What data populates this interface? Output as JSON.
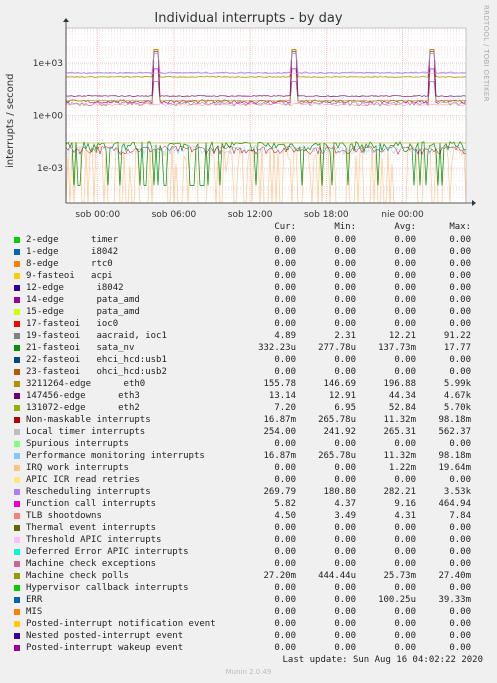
{
  "chart_data": {
    "type": "line",
    "title": "Individual interrupts - by day",
    "ylabel": "interrupts / second",
    "yscale": "log",
    "ylim": [
      1e-05,
      100000
    ],
    "yticks": [
      "1e+03",
      "1e+00",
      "1e-03"
    ],
    "xticks": [
      "sob 00:00",
      "sob 06:00",
      "sob 12:00",
      "sob 18:00",
      "nie 00:00"
    ],
    "columns": [
      "Cur:",
      "Min:",
      "Avg:",
      "Max:"
    ],
    "series": [
      {
        "name": "2-edge      timer",
        "color": "#00cc00",
        "values": [
          "0.00",
          "0.00",
          "0.00",
          "0.00"
        ]
      },
      {
        "name": "1-edge      i8042",
        "color": "#0066b3",
        "values": [
          "0.00",
          "0.00",
          "0.00",
          "0.00"
        ]
      },
      {
        "name": "8-edge      rtc0",
        "color": "#ff8000",
        "values": [
          "0.00",
          "0.00",
          "0.00",
          "0.00"
        ]
      },
      {
        "name": "9-fasteoi   acpi",
        "color": "#ffcc00",
        "values": [
          "0.00",
          "0.00",
          "0.00",
          "0.00"
        ]
      },
      {
        "name": "12-edge      i8042",
        "color": "#330099",
        "values": [
          "0.00",
          "0.00",
          "0.00",
          "0.00"
        ]
      },
      {
        "name": "14-edge      pata_amd",
        "color": "#990099",
        "values": [
          "0.00",
          "0.00",
          "0.00",
          "0.00"
        ]
      },
      {
        "name": "15-edge      pata_amd",
        "color": "#ccff00",
        "values": [
          "0.00",
          "0.00",
          "0.00",
          "0.00"
        ]
      },
      {
        "name": "17-fasteoi   ioc0",
        "color": "#ff0000",
        "values": [
          "0.00",
          "0.00",
          "0.00",
          "0.00"
        ]
      },
      {
        "name": "19-fasteoi   aacraid, ioc1",
        "color": "#808080",
        "values": [
          "4.89",
          "2.31",
          "12.21",
          "91.22"
        ]
      },
      {
        "name": "21-fasteoi   sata_nv",
        "color": "#008f00",
        "values": [
          "332.23u",
          "277.78u",
          "137.73m",
          "17.77"
        ]
      },
      {
        "name": "22-fasteoi   ehci_hcd:usb1",
        "color": "#00487d",
        "values": [
          "0.00",
          "0.00",
          "0.00",
          "0.00"
        ]
      },
      {
        "name": "23-fasteoi   ohci_hcd:usb2",
        "color": "#b35a00",
        "values": [
          "0.00",
          "0.00",
          "0.00",
          "0.00"
        ]
      },
      {
        "name": "3211264-edge      eth0",
        "color": "#b38f00",
        "values": [
          "155.78",
          "146.69",
          "196.88",
          "5.99k"
        ]
      },
      {
        "name": "147456-edge      eth3",
        "color": "#6b006b",
        "values": [
          "13.14",
          "12.91",
          "44.34",
          "4.67k"
        ]
      },
      {
        "name": "131072-edge      eth2",
        "color": "#8fb300",
        "values": [
          "7.20",
          "6.95",
          "52.84",
          "5.70k"
        ]
      },
      {
        "name": "Non-maskable interrupts",
        "color": "#b30000",
        "values": [
          "16.87m",
          "265.78u",
          "11.32m",
          "98.18m"
        ]
      },
      {
        "name": "Local timer interrupts",
        "color": "#bebebe",
        "values": [
          "254.00",
          "241.92",
          "265.31",
          "562.37"
        ]
      },
      {
        "name": "Spurious interrupts",
        "color": "#80ff80",
        "values": [
          "0.00",
          "0.00",
          "0.00",
          "0.00"
        ]
      },
      {
        "name": "Performance monitoring interrupts",
        "color": "#80c9ff",
        "values": [
          "16.87m",
          "265.78u",
          "11.32m",
          "98.18m"
        ]
      },
      {
        "name": "IRQ work interrupts",
        "color": "#ffc080",
        "values": [
          "0.00",
          "0.00",
          "1.22m",
          "19.64m"
        ]
      },
      {
        "name": "APIC ICR read retries",
        "color": "#ffe680",
        "values": [
          "0.00",
          "0.00",
          "0.00",
          "0.00"
        ]
      },
      {
        "name": "Rescheduling interrupts",
        "color": "#aa80ff",
        "values": [
          "269.79",
          "180.80",
          "282.21",
          "3.53k"
        ]
      },
      {
        "name": "Function call interrupts",
        "color": "#ee00cc",
        "values": [
          "5.82",
          "4.37",
          "9.16",
          "464.94"
        ]
      },
      {
        "name": "TLB shootdowns",
        "color": "#ff8080",
        "values": [
          "4.50",
          "3.49",
          "4.31",
          "7.84"
        ]
      },
      {
        "name": "Thermal event interrupts",
        "color": "#666600",
        "values": [
          "0.00",
          "0.00",
          "0.00",
          "0.00"
        ]
      },
      {
        "name": "Threshold APIC interrupts",
        "color": "#ffbfff",
        "values": [
          "0.00",
          "0.00",
          "0.00",
          "0.00"
        ]
      },
      {
        "name": "Deferred Error APIC interrupts",
        "color": "#00ffcc",
        "values": [
          "0.00",
          "0.00",
          "0.00",
          "0.00"
        ]
      },
      {
        "name": "Machine check exceptions",
        "color": "#cc6699",
        "values": [
          "0.00",
          "0.00",
          "0.00",
          "0.00"
        ]
      },
      {
        "name": "Machine check polls",
        "color": "#999900",
        "values": [
          "27.20m",
          "444.44u",
          "25.73m",
          "27.40m"
        ]
      },
      {
        "name": "Hypervisor callback interrupts",
        "color": "#00cc00",
        "values": [
          "0.00",
          "0.00",
          "0.00",
          "0.00"
        ]
      },
      {
        "name": "ERR",
        "color": "#0066b3",
        "values": [
          "0.00",
          "0.00",
          "100.25u",
          "39.33m"
        ]
      },
      {
        "name": "MIS",
        "color": "#ff8000",
        "values": [
          "0.00",
          "0.00",
          "0.00",
          "0.00"
        ]
      },
      {
        "name": "Posted-interrupt notification event",
        "color": "#ffcc00",
        "values": [
          "0.00",
          "0.00",
          "0.00",
          "0.00"
        ]
      },
      {
        "name": "Nested posted-interrupt event",
        "color": "#330099",
        "values": [
          "0.00",
          "0.00",
          "0.00",
          "0.00"
        ]
      },
      {
        "name": "Posted-interrupt wakeup event",
        "color": "#990099",
        "values": [
          "0.00",
          "0.00",
          "0.00",
          "0.00"
        ]
      }
    ]
  },
  "footer": {
    "last_update": "Last update: Sun Aug 16 04:02:22 2020",
    "munin_version": "Munin 2.0.49"
  },
  "side_credit": "RRDTOOL / TOBI OETIKER"
}
